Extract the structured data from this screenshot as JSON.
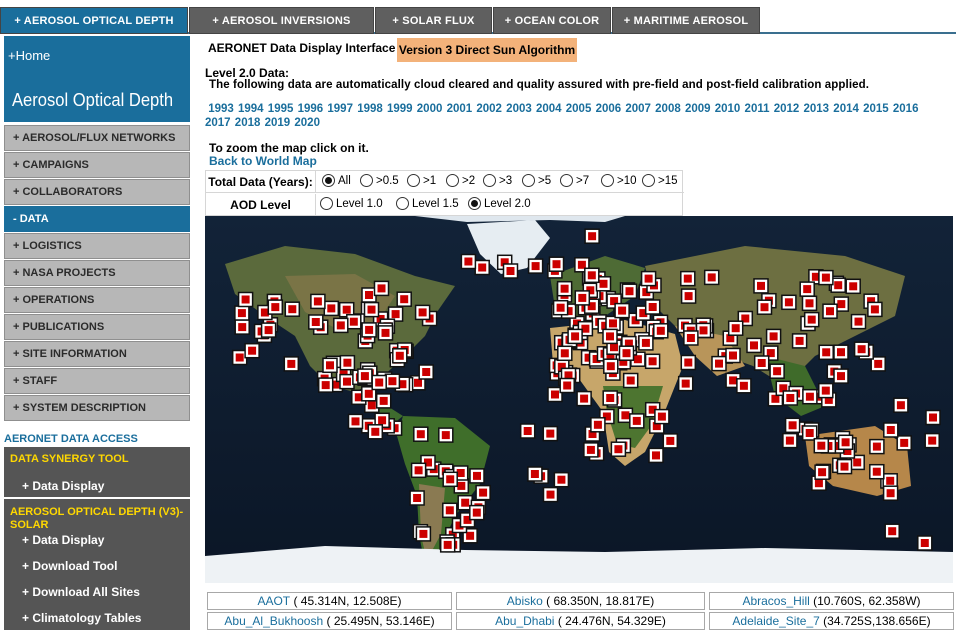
{
  "top_tabs": [
    "+ AEROSOL OPTICAL DEPTH",
    "+ AEROSOL INVERSIONS",
    "+ SOLAR FLUX",
    "+ OCEAN COLOR",
    "+ MARITIME AEROSOL"
  ],
  "sidebar": {
    "home": "+Home",
    "title": "Aerosol Optical Depth",
    "items": [
      {
        "label": "+ AEROSOL/FLUX NETWORKS"
      },
      {
        "label": "+ CAMPAIGNS"
      },
      {
        "label": "+ COLLABORATORS"
      },
      {
        "label": "- DATA"
      },
      {
        "label": "+ LOGISTICS"
      },
      {
        "label": "+ NASA PROJECTS"
      },
      {
        "label": "+ OPERATIONS"
      },
      {
        "label": "+ PUBLICATIONS"
      },
      {
        "label": "+ SITE INFORMATION"
      },
      {
        "label": "+ STAFF"
      },
      {
        "label": "+ SYSTEM DESCRIPTION"
      }
    ],
    "access_heading": "AERONET DATA ACCESS",
    "synergy": {
      "heading": "DATA SYNERGY TOOL",
      "link": "+ Data Display"
    },
    "aod": {
      "heading_line1": "AEROSOL OPTICAL DEPTH (V3)-",
      "heading_line2": "SOLAR",
      "links": [
        "+ Data Display",
        "+ Download Tool",
        "+ Download All Sites",
        "+ Climatology Tables"
      ]
    }
  },
  "main": {
    "interface_title": "AERONET Data Display Interface",
    "version": "Version 3 Direct Sun Algorithm",
    "level_heading": "Level 2.0 Data:",
    "description": "The following data are automatically cloud cleared and quality assured with pre-field and post-field calibration applied.",
    "years": [
      "1993",
      "1994",
      "1995",
      "1996",
      "1997",
      "1998",
      "1999",
      "2000",
      "2001",
      "2002",
      "2003",
      "2004",
      "2005",
      "2006",
      "2007",
      "2008",
      "2009",
      "2010",
      "2011",
      "2012",
      "2013",
      "2014",
      "2015",
      "2016",
      "2017",
      "2018",
      "2019",
      "2020"
    ],
    "zoom_note": "To zoom the map click on it.",
    "back_link": "Back to World Map",
    "filters": {
      "total_label": "Total Data (Years):",
      "total_options": [
        {
          "label": "All",
          "selected": true
        },
        {
          "label": ">0.5",
          "selected": false
        },
        {
          "label": ">1",
          "selected": false
        },
        {
          "label": ">2",
          "selected": false
        },
        {
          "label": ">3",
          "selected": false
        },
        {
          "label": ">5",
          "selected": false
        },
        {
          "label": ">7",
          "selected": false
        },
        {
          "label": ">10",
          "selected": false
        },
        {
          "label": ">15",
          "selected": false
        }
      ],
      "aod_label": "AOD Level",
      "aod_options": [
        {
          "label": "Level 1.0",
          "selected": false
        },
        {
          "label": "Level 1.5",
          "selected": false
        },
        {
          "label": "Level 2.0",
          "selected": true
        }
      ]
    },
    "sites": [
      {
        "name": "AAOT",
        "coords": "( 45.314N, 12.508E)"
      },
      {
        "name": "Abisko",
        "coords": "( 68.350N, 18.817E)"
      },
      {
        "name": "Abracos_Hill",
        "coords": "(10.760S, 62.358W)"
      },
      {
        "name": "Abu_Al_Bukhoosh",
        "coords": "( 25.495N, 53.146E)"
      },
      {
        "name": "Abu_Dhabi",
        "coords": "( 24.476N, 54.329E)"
      },
      {
        "name": "Adelaide_Site_7",
        "coords": "(34.725S,138.656E)"
      }
    ]
  },
  "colors": {
    "accent": "#1a6e9c",
    "tab_inactive": "#5f5f5f",
    "nav_gray": "#b7b7b7",
    "highlight": "#f3b27a",
    "panel_yellow": "#ffd800",
    "marker_red": "#cc0000"
  },
  "icons": {
    "site_marker": "site-marker-icon"
  }
}
